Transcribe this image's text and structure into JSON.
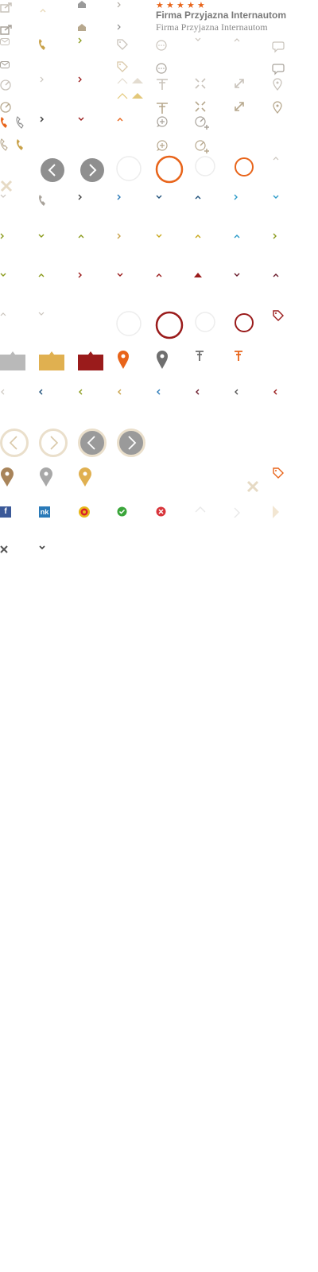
{
  "brand": {
    "title_sans": "Firma Przyjazna Internautom",
    "title_serif": "Firma Przyjazna Internautom",
    "star_count": 5,
    "star_glyph": "★"
  },
  "social": {
    "facebook_glyph": "f",
    "nk_glyph": "nk"
  },
  "colors": {
    "gray": "#b9b3ab",
    "beige": "#d9c8a8",
    "gold": "#c9a24a",
    "orange": "#e8641a",
    "darkred": "#9a1b1b",
    "teal": "#2a7ab8",
    "olive": "#8a9a1b",
    "dark": "#555555"
  }
}
